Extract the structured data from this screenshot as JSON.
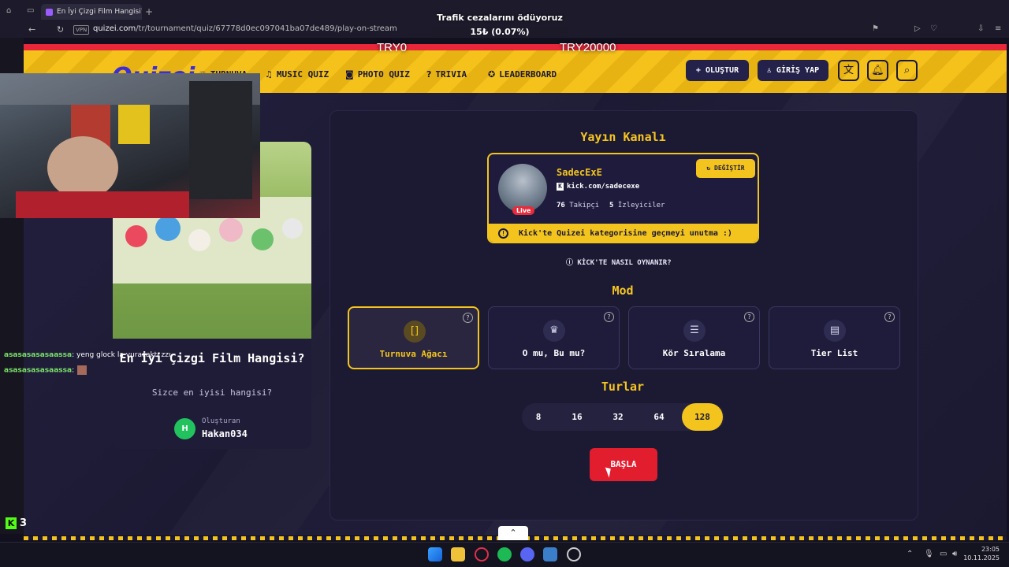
{
  "browser": {
    "tab_title": "En İyi Çizgi Film Hangisi?",
    "url_domain": "quizei.com",
    "url_path": "/tr/tournament/quiz/67778d0ec097041ba07de489/play-on-stream",
    "vpn_badge": "VPN"
  },
  "stream_overlay": {
    "alert_title": "Trafik cezalarını ödüyoruz",
    "alert_progress": "15₺ (0.07%)",
    "goal_left": "TRY0",
    "goal_right": "TRY20000",
    "viewer_count": "3",
    "kick_logo": "K",
    "chat": [
      {
        "user": "asasasasasaassa",
        "message": ": yeng glock la vuracaktı zzı"
      },
      {
        "user": "asasasasasaassa",
        "message": ":"
      }
    ]
  },
  "header": {
    "logo": "Quizei",
    "nav": [
      {
        "icon": "trophy-icon",
        "label": "TURNUVA"
      },
      {
        "icon": "music-icon",
        "label": "MUSIC QUIZ"
      },
      {
        "icon": "camera-icon",
        "label": "PHOTO QUIZ"
      },
      {
        "icon": "question-icon",
        "label": "TRIVIA"
      },
      {
        "icon": "award-icon",
        "label": "LEADERBOARD"
      }
    ],
    "create_label": "+ OLUŞTUR",
    "login_label": "GİRİŞ YAP"
  },
  "quiz": {
    "title": "En İyi Çizgi Film Hangisi?",
    "subtitle": "Sizce en iyisi hangisi?",
    "creator_label": "Oluşturan",
    "creator_name": "Hakan034",
    "creator_initial": "H"
  },
  "panel": {
    "channel_heading": "Yayın Kanalı",
    "streamer_name": "SadecExE",
    "streamer_url": "kick.com/sadecexe",
    "followers_count": "76",
    "followers_label": "Takipçi",
    "viewers_count": "5",
    "viewers_label": "İzleyiciler",
    "live_label": "Live",
    "change_label": "DEĞİŞTİR",
    "warning": "Kick'te Quizei kategorisine geçmeyi unutma :)",
    "howto": "KİCK'TE NASIL OYNANIR?",
    "mode_heading": "Mod",
    "modes": [
      {
        "label": "Turnuva Ağacı",
        "icon": "bracket-icon",
        "glyph": "[]",
        "selected": true
      },
      {
        "label": "O mu, Bu mu?",
        "icon": "crown-icon",
        "glyph": "♛",
        "selected": false
      },
      {
        "label": "Kör Sıralama",
        "icon": "list-icon",
        "glyph": "☰",
        "selected": false
      },
      {
        "label": "Tier List",
        "icon": "table-icon",
        "glyph": "▤",
        "selected": false
      }
    ],
    "rounds_heading": "Turlar",
    "rounds": [
      "8",
      "16",
      "32",
      "64",
      "128"
    ],
    "selected_round": "128",
    "start_label": "BAŞLA"
  },
  "taskbar": {
    "time": "23:05",
    "date": "10.11.2025"
  },
  "colors": {
    "accent_yellow": "#f3c41d",
    "start_red": "#e11d2e",
    "header_red_strip": "#e8283a",
    "panel_bg": "#1c1a33"
  }
}
